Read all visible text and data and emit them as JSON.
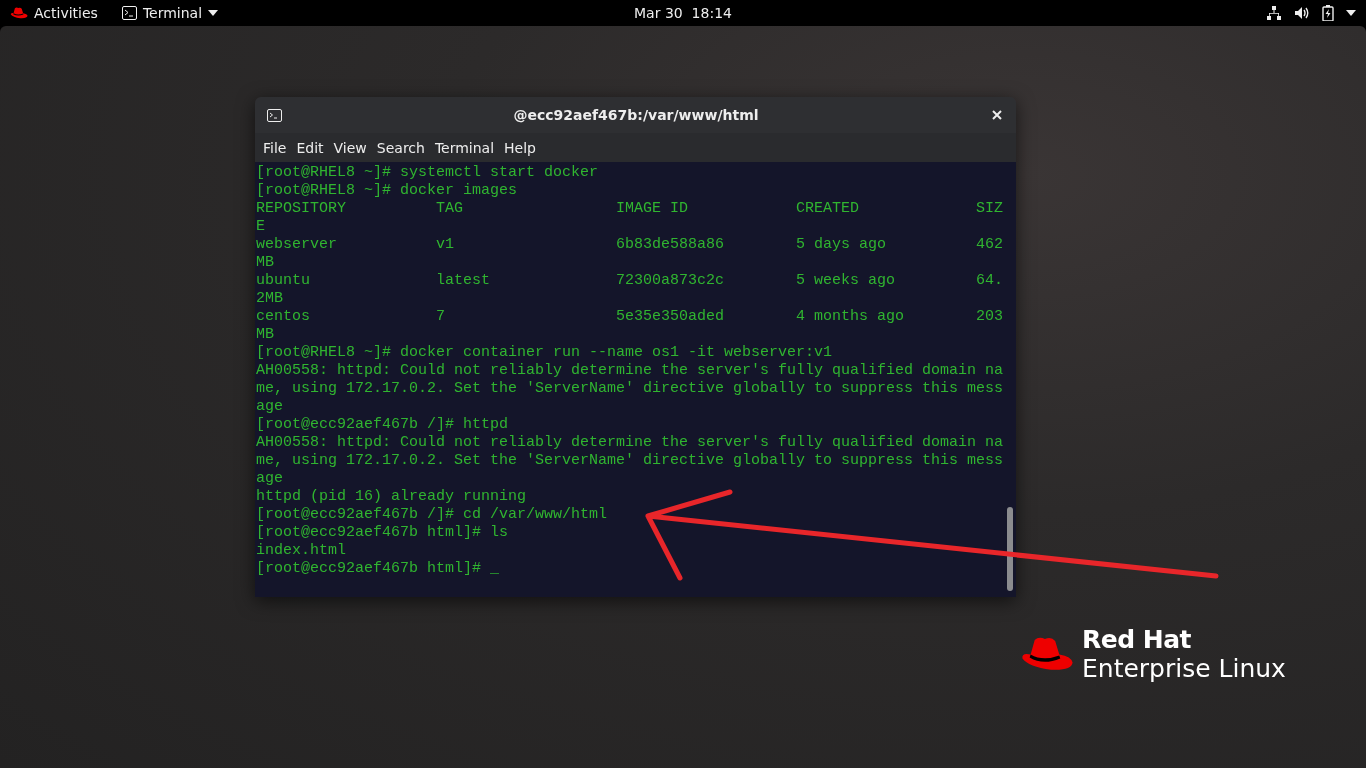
{
  "top_bar": {
    "activities": "Activities",
    "app_menu": "Terminal",
    "clock": "Mar 30  18:14"
  },
  "terminal": {
    "title": "@ecc92aef467b:/var/www/html",
    "menu": [
      "File",
      "Edit",
      "View",
      "Search",
      "Terminal",
      "Help"
    ],
    "lines": [
      "[root@RHEL8 ~]# systemctl start docker",
      "[root@RHEL8 ~]# docker images",
      "REPOSITORY          TAG                 IMAGE ID            CREATED             SIZ",
      "E",
      "webserver           v1                  6b83de588a86        5 days ago          462",
      "MB",
      "ubuntu              latest              72300a873c2c        5 weeks ago         64.",
      "2MB",
      "centos              7                   5e35e350aded        4 months ago        203",
      "MB",
      "[root@RHEL8 ~]# docker container run --name os1 -it webserver:v1",
      "AH00558: httpd: Could not reliably determine the server's fully qualified domain na",
      "me, using 172.17.0.2. Set the 'ServerName' directive globally to suppress this mess",
      "age",
      "[root@ecc92aef467b /]# httpd",
      "AH00558: httpd: Could not reliably determine the server's fully qualified domain na",
      "me, using 172.17.0.2. Set the 'ServerName' directive globally to suppress this mess",
      "age",
      "httpd (pid 16) already running",
      "[root@ecc92aef467b /]# cd /var/www/html",
      "[root@ecc92aef467b html]# ls",
      "index.html",
      "[root@ecc92aef467b html]# _"
    ]
  },
  "branding": {
    "line_1": "Red Hat",
    "line_2": "Enterprise Linux"
  }
}
